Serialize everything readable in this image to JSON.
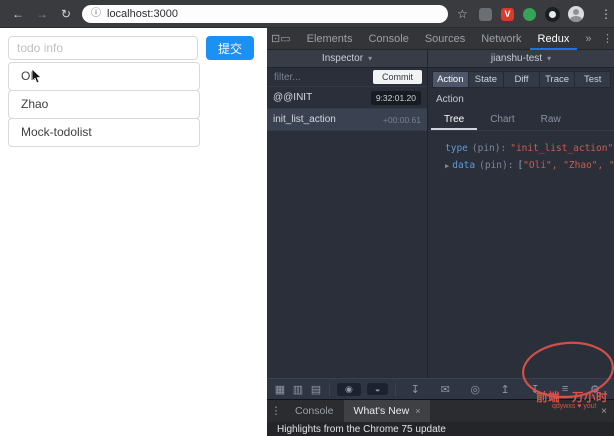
{
  "browser": {
    "back": "←",
    "forward": "→",
    "refresh": "↻",
    "info": "ⓘ",
    "url": "localhost:3000",
    "star": "☆",
    "ext_v": "V",
    "menu": "⋮"
  },
  "page": {
    "input_placeholder": "todo info",
    "submit_label": "提交",
    "todos": [
      "Oli",
      "Zhao",
      "Mock-todolist"
    ]
  },
  "devtools": {
    "inspect_icon": "⊡",
    "device_icon": "▭",
    "tabs": [
      "Elements",
      "Console",
      "Sources",
      "Network",
      "Redux"
    ],
    "overflow": "»",
    "menu": "⋮",
    "close": "×",
    "redux": {
      "inspector_label": "Inspector",
      "instance_label": "jianshu-test",
      "dropdown_arrow": "▾",
      "filter_placeholder": "filter...",
      "commit_label": "Commit",
      "actions": [
        {
          "name": "@@INIT",
          "time": "9:32:01.20"
        },
        {
          "name": "init_list_action",
          "time": "+00:00.61"
        }
      ],
      "detail_tabs": [
        "Action",
        "State",
        "Diff",
        "Trace",
        "Test"
      ],
      "section_label": "Action",
      "view_tabs": [
        "Tree",
        "Chart",
        "Raw"
      ],
      "tree": {
        "expand_arrow": "▶",
        "line1": {
          "key": "type",
          "pin": "(pin):",
          "value": "\"init_list_action\""
        },
        "line2": {
          "key": "data",
          "pin": "(pin):",
          "open": "[",
          "items": "\"Oli\", \"Zhao\", \"Mock-todol…\"",
          "close": "]"
        }
      },
      "toolbar_icons": [
        {
          "glyph": "▦"
        },
        {
          "glyph": "▥"
        },
        {
          "glyph": "▤"
        },
        {
          "glyph": "◉"
        },
        {
          "glyph": "◒"
        },
        {
          "glyph": "↧"
        },
        {
          "glyph": "✉"
        },
        {
          "glyph": "◎"
        },
        {
          "glyph": "↥"
        },
        {
          "glyph": "↧"
        },
        {
          "glyph": "≡"
        },
        {
          "glyph": "⚙"
        }
      ]
    },
    "drawer": {
      "menu": "⋮",
      "tabs": [
        "Console",
        "What's New"
      ],
      "tab_close": "×",
      "close": "×",
      "content": "Highlights from the Chrome 75 update"
    }
  },
  "watermark": {
    "line1": "前端一万小时",
    "line2": "qdywxs ♥ you!"
  }
}
